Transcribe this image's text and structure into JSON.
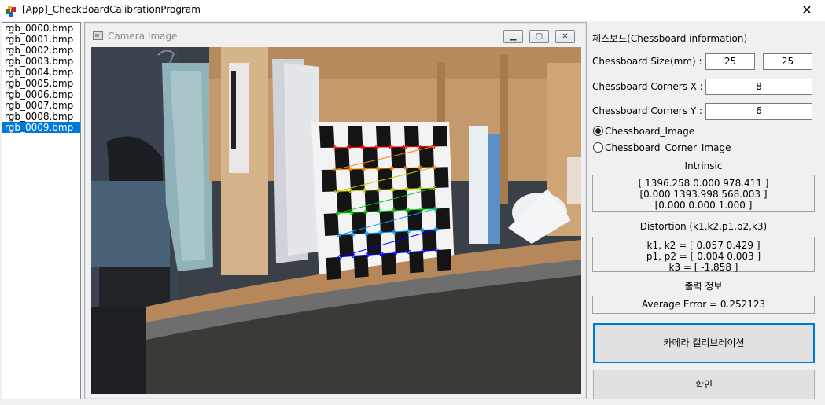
{
  "window": {
    "title": "[App]_CheckBoardCalibrationProgram",
    "close_glyph": "✕"
  },
  "files": {
    "items": [
      "rgb_0000.bmp",
      "rgb_0001.bmp",
      "rgb_0002.bmp",
      "rgb_0003.bmp",
      "rgb_0004.bmp",
      "rgb_0005.bmp",
      "rgb_0006.bmp",
      "rgb_0007.bmp",
      "rgb_0008.bmp",
      "rgb_0009.bmp"
    ],
    "selected_index": 9
  },
  "camera": {
    "title": "Camera Image",
    "min_glyph": "▁",
    "max_glyph": "▢",
    "close_glyph": "✕",
    "corner_grid": {
      "cols": 8,
      "rows": 6
    }
  },
  "chessboard": {
    "section_title": "체스보드(Chessboard information)",
    "size_label": "Chessboard Size(mm) :",
    "size_x": "25",
    "size_y": "25",
    "corners_x_label": "Chessboard Corners X :",
    "corners_x": "8",
    "corners_y_label": "Chessboard Corners Y :",
    "corners_y": "6",
    "radio_image_label": "Chessboard_Image",
    "radio_corner_label": "Chessboard_Corner_Image",
    "radio_selected": "Chessboard_Image"
  },
  "intrinsic": {
    "title": "Intrinsic",
    "lines": [
      "[ 1396.258 0.000 978.411 ]",
      "[0.000 1393.998 568.003 ]",
      "[0.000 0.000 1.000 ]"
    ]
  },
  "distortion": {
    "title": "Distortion (k1,k2,p1,p2,k3)",
    "lines": [
      "k1, k2 = [ 0.057 0.429 ]",
      "p1, p2 = [ 0.004 0.003 ]",
      "k3 = [ -1.858 ]"
    ]
  },
  "output": {
    "title": "출력 정보",
    "average_error": "Average Error = 0.252123"
  },
  "buttons": {
    "calibrate": "카메라 캘리브레이션",
    "confirm": "확인"
  },
  "colors": {
    "selection": "#0078d7",
    "corner_rows": [
      "#ff0000",
      "#ff8000",
      "#c8c800",
      "#00c800",
      "#00a0ff",
      "#0000ff"
    ]
  }
}
